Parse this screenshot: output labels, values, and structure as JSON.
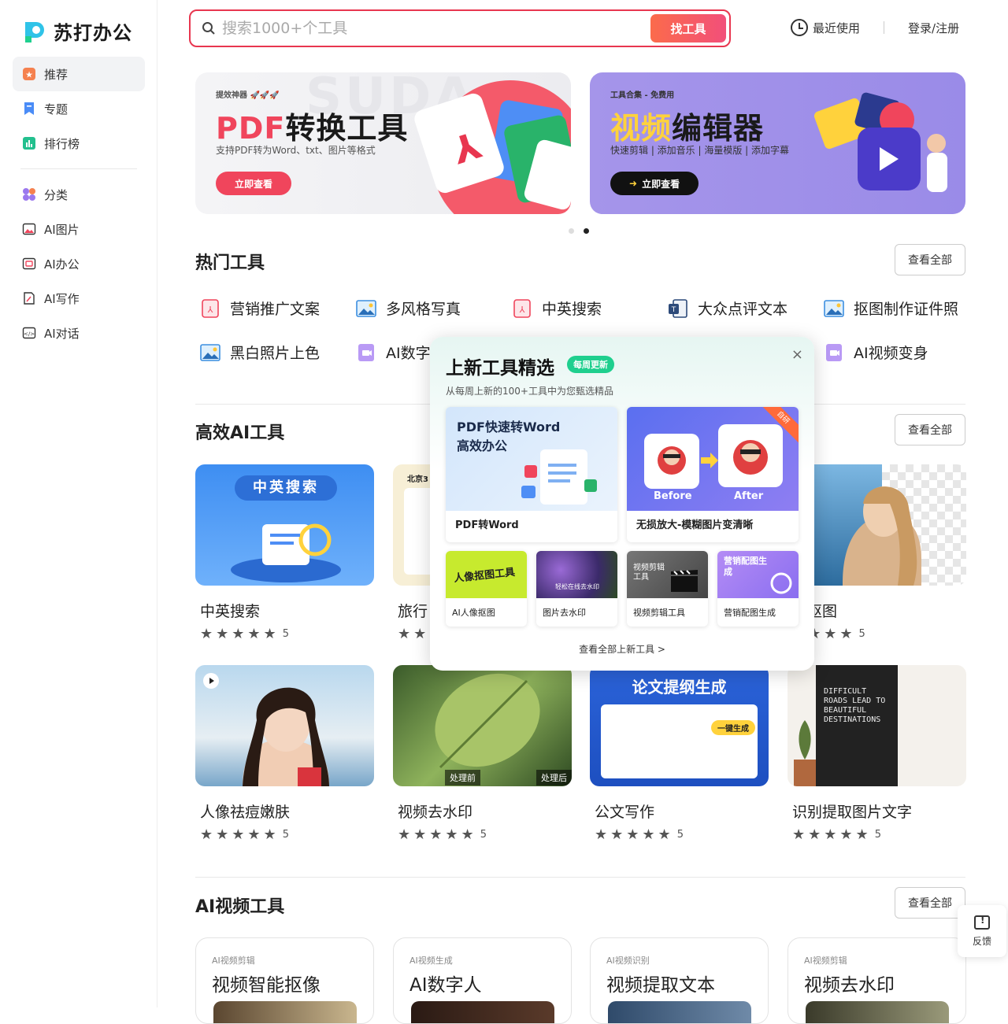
{
  "brand": {
    "name": "苏打办公"
  },
  "sidebar": {
    "items": [
      {
        "label": "推荐",
        "icon": "star-icon",
        "color": "#f5814f",
        "active": true
      },
      {
        "label": "专题",
        "icon": "bookmark-icon",
        "color": "#4a8cf7"
      },
      {
        "label": "排行榜",
        "icon": "chart-icon",
        "color": "#22c08e"
      },
      {
        "label": "分类",
        "icon": "grid-icon",
        "color": "#9b78ee"
      },
      {
        "label": "AI图片",
        "icon": "image-icon",
        "color": "#333"
      },
      {
        "label": "AI办公",
        "icon": "office-icon",
        "color": "#333"
      },
      {
        "label": "AI写作",
        "icon": "write-icon",
        "color": "#333"
      },
      {
        "label": "AI对话",
        "icon": "chat-icon",
        "color": "#333"
      }
    ]
  },
  "header": {
    "search_placeholder": "搜索1000+个工具",
    "search_button": "找工具",
    "recent": "最近使用",
    "login": "登录/注册"
  },
  "banners": [
    {
      "small": "提效神器 🚀🚀🚀",
      "title_a": "PDF",
      "title_b": "转换工具",
      "desc": "支持PDF转为Word、txt、图片等格式",
      "button": "立即查看"
    },
    {
      "small": "工具合集 - 免费用",
      "title_a": "视频",
      "title_b": "编辑器",
      "desc": "快速剪辑 | 添加音乐 | 海量模版 | 添加字幕",
      "button": "立即查看"
    }
  ],
  "hot": {
    "title": "热门工具",
    "view_all": "查看全部",
    "items": [
      {
        "label": "营销推广文案",
        "icon": "pdf-icon",
        "color": "#f0455c"
      },
      {
        "label": "多风格写真",
        "icon": "image-icon",
        "color": "#3d8fe0"
      },
      {
        "label": "中英搜索",
        "icon": "pdf-icon",
        "color": "#f0455c"
      },
      {
        "label": "大众点评文本",
        "icon": "doc-icon",
        "color": "#2d4a7a"
      },
      {
        "label": "抠图制作证件照",
        "icon": "image-icon",
        "color": "#3d8fe0"
      },
      {
        "label": "黑白照片上色",
        "icon": "image-icon",
        "color": "#3d8fe0"
      },
      {
        "label": "AI数字",
        "icon": "video-icon",
        "color": "#9b6ef0"
      },
      {
        "label": "AI视频变身",
        "icon": "video-icon",
        "color": "#9b6ef0"
      }
    ]
  },
  "efficient": {
    "title": "高效AI工具",
    "view_all": "查看全部",
    "cards": [
      {
        "name": "中英搜索",
        "stars": "★★★★★",
        "rating": "5",
        "thumb_text": "中英搜索"
      },
      {
        "name": "旅行",
        "stars": "★★",
        "rating": "",
        "thumb_text": "北京3"
      },
      {
        "name": "",
        "stars": "",
        "rating": "",
        "thumb_text": ""
      },
      {
        "name": "像抠图",
        "stars": "★★★★",
        "rating": "5",
        "thumb_text": ""
      },
      {
        "name": "人像祛痘嫩肤",
        "stars": "★★★★★",
        "rating": "5",
        "thumb_text": ""
      },
      {
        "name": "视频去水印",
        "stars": "★★★★★",
        "rating": "5",
        "thumb_text": "处理前",
        "thumb_text2": "处理后"
      },
      {
        "name": "公文写作",
        "stars": "★★★★★",
        "rating": "5",
        "thumb_text": "论文提纲生成"
      },
      {
        "name": "识别提取图片文字",
        "stars": "★★★★★",
        "rating": "5",
        "thumb_text": "DIFFICULT ROADS LEAD TO BEAUTIFUL DESTINATIONS"
      }
    ]
  },
  "video": {
    "title": "AI视频工具",
    "view_all": "查看全部",
    "cards": [
      {
        "tag": "AI视频剪辑",
        "name": "视频智能抠像"
      },
      {
        "tag": "AI视频生成",
        "name": "AI数字人"
      },
      {
        "tag": "AI视频识别",
        "name": "视频提取文本"
      },
      {
        "tag": "AI视频剪辑",
        "name": "视频去水印"
      }
    ]
  },
  "popup": {
    "title": "上新工具精选",
    "badge": "每周更新",
    "subtitle": "从每周上新的100+工具中为您甄选精品",
    "close": "×",
    "big": [
      {
        "label": "PDF转Word",
        "img_text": "PDF快速转Word\n高效办公"
      },
      {
        "label": "无损放大-模糊图片变清晰",
        "before": "Before",
        "after": "After",
        "corner": "自研"
      }
    ],
    "small": [
      {
        "label": "AI人像抠图",
        "img_text": "人像抠图工具"
      },
      {
        "label": "图片去水印",
        "img_text": "轻松在线去水印"
      },
      {
        "label": "视频剪辑工具",
        "img_text": "视频剪辑工具"
      },
      {
        "label": "营销配图生成",
        "img_text": "营销配图生成"
      }
    ],
    "more": "查看全部上新工具 >"
  },
  "feedback": {
    "label": "反馈"
  }
}
